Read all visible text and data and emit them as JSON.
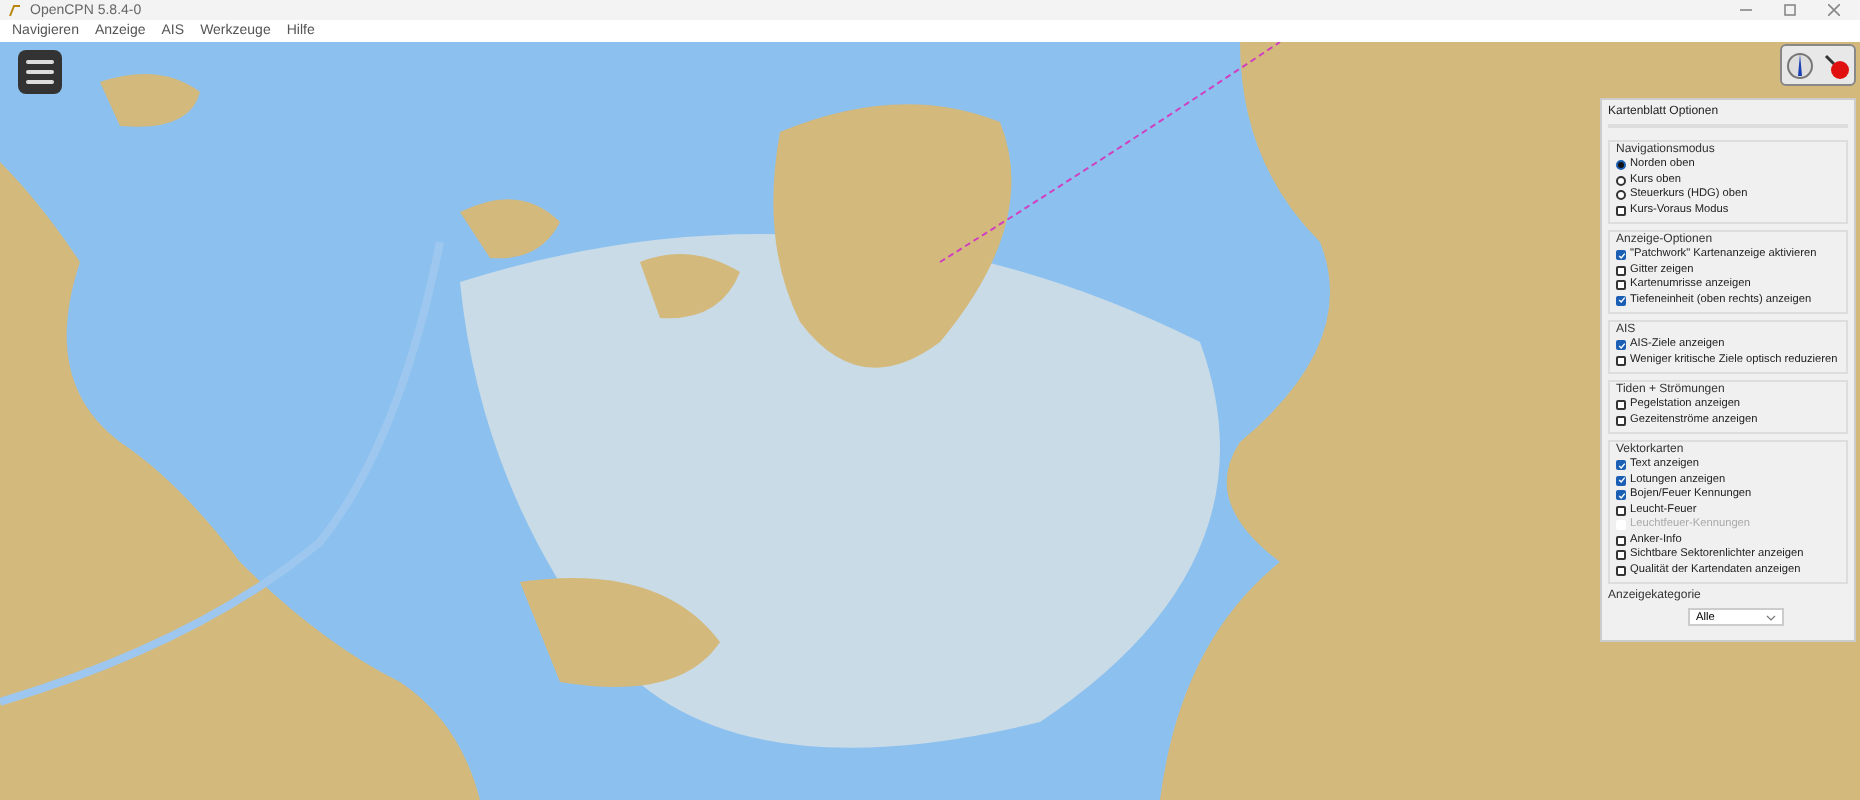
{
  "window": {
    "title": "OpenCPN 5.8.4-0"
  },
  "menu": [
    "Navigieren",
    "Anzeige",
    "AIS",
    "Werkzeuge",
    "Hilfe"
  ],
  "panel": {
    "title": "Kartenblatt Optionen",
    "sections": [
      {
        "title": "Navigationsmodus",
        "items": [
          {
            "kind": "radio",
            "label": "Norden oben",
            "selected": true,
            "disabled": false
          },
          {
            "kind": "radio",
            "label": "Kurs oben",
            "selected": false,
            "disabled": false
          },
          {
            "kind": "radio",
            "label": "Steuerkurs (HDG) oben",
            "selected": false,
            "disabled": false
          },
          {
            "kind": "checkbox",
            "label": "Kurs-Voraus Modus",
            "checked": false,
            "disabled": false
          }
        ]
      },
      {
        "title": "Anzeige-Optionen",
        "items": [
          {
            "kind": "checkbox",
            "label": "\"Patchwork\" Kartenanzeige aktivieren",
            "checked": true,
            "disabled": false
          },
          {
            "kind": "checkbox",
            "label": "Gitter zeigen",
            "checked": false,
            "disabled": false
          },
          {
            "kind": "checkbox",
            "label": "Kartenumrisse anzeigen",
            "checked": false,
            "disabled": false
          },
          {
            "kind": "checkbox",
            "label": "Tiefeneinheit (oben rechts) anzeigen",
            "checked": true,
            "disabled": false
          }
        ]
      },
      {
        "title": "AIS",
        "items": [
          {
            "kind": "checkbox",
            "label": "AIS-Ziele anzeigen",
            "checked": true,
            "disabled": false
          },
          {
            "kind": "checkbox",
            "label": "Weniger kritische Ziele optisch reduzieren",
            "checked": false,
            "disabled": false
          }
        ]
      },
      {
        "title": "Tiden + Strömungen",
        "items": [
          {
            "kind": "checkbox",
            "label": "Pegelstation anzeigen",
            "checked": false,
            "disabled": false
          },
          {
            "kind": "checkbox",
            "label": "Gezeitenströme anzeigen",
            "checked": false,
            "disabled": false
          }
        ]
      },
      {
        "title": "Vektorkarten",
        "items": [
          {
            "kind": "checkbox",
            "label": "Text anzeigen",
            "checked": true,
            "disabled": false
          },
          {
            "kind": "checkbox",
            "label": "Lotungen anzeigen",
            "checked": true,
            "disabled": false
          },
          {
            "kind": "checkbox",
            "label": "Bojen/Feuer Kennungen",
            "checked": true,
            "disabled": false
          },
          {
            "kind": "checkbox",
            "label": "Leucht-Feuer",
            "checked": false,
            "disabled": false
          },
          {
            "kind": "checkbox",
            "label": "Leuchtfeuer-Kennungen",
            "checked": false,
            "disabled": true
          },
          {
            "kind": "checkbox",
            "label": "Anker-Info",
            "checked": false,
            "disabled": false
          },
          {
            "kind": "checkbox",
            "label": "Sichtbare Sektorenlichter anzeigen",
            "checked": false,
            "disabled": false
          },
          {
            "kind": "checkbox",
            "label": "Qualität der Kartendaten anzeigen",
            "checked": false,
            "disabled": false
          }
        ]
      }
    ],
    "category": {
      "label": "Anzeigekategorie",
      "value": "Alle"
    }
  }
}
